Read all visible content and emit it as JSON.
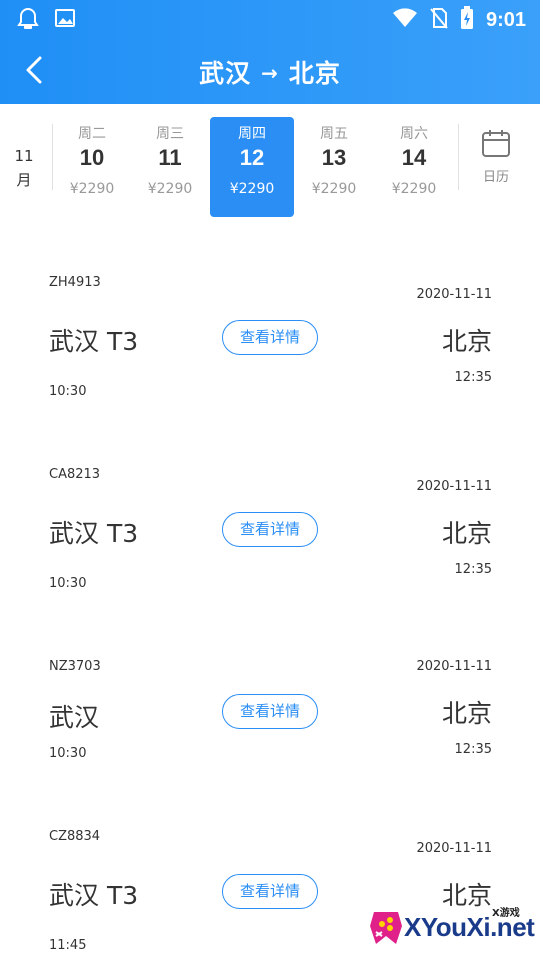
{
  "status_bar": {
    "time": "9:01"
  },
  "header": {
    "from": "武汉",
    "arrow": "→",
    "to": "北京"
  },
  "date_strip": {
    "month": "11月",
    "calendar_label": "日历",
    "days": [
      {
        "weekday": "周二",
        "day": "10",
        "price": "¥2290"
      },
      {
        "weekday": "周三",
        "day": "11",
        "price": "¥2290"
      },
      {
        "weekday": "周四",
        "day": "12",
        "price": "¥2290",
        "selected": true
      },
      {
        "weekday": "周五",
        "day": "13",
        "price": "¥2290"
      },
      {
        "weekday": "周六",
        "day": "14",
        "price": "¥2290"
      }
    ]
  },
  "detail_label": "查看详情",
  "flights": [
    {
      "flight_no": "ZH4913",
      "date": "2020-11-11",
      "dep_city": "武汉 T3",
      "arr_city": "北京",
      "dep_time": "10:30",
      "arr_time": "12:35"
    },
    {
      "flight_no": "CA8213",
      "date": "2020-11-11",
      "dep_city": "武汉 T3",
      "arr_city": "北京",
      "dep_time": "10:30",
      "arr_time": "12:35"
    },
    {
      "flight_no": "NZ3703",
      "date": "2020-11-11",
      "dep_city": "武汉",
      "arr_city": "北京",
      "dep_time": "10:30",
      "arr_time": "12:35"
    },
    {
      "flight_no": "CZ8834",
      "date": "2020-11-11",
      "dep_city": "武汉 T3",
      "arr_city": "北京",
      "dep_time": "11:45",
      "arr_time": ""
    }
  ],
  "watermark": {
    "text": "XYouXi.net",
    "small": "X游戏"
  },
  "colors": {
    "primary": "#2a8ef5",
    "header_start": "#1f8ff6",
    "header_end": "#3aa0fa"
  },
  "icons": {
    "back": "chevron-left-icon",
    "calendar": "calendar-icon"
  }
}
